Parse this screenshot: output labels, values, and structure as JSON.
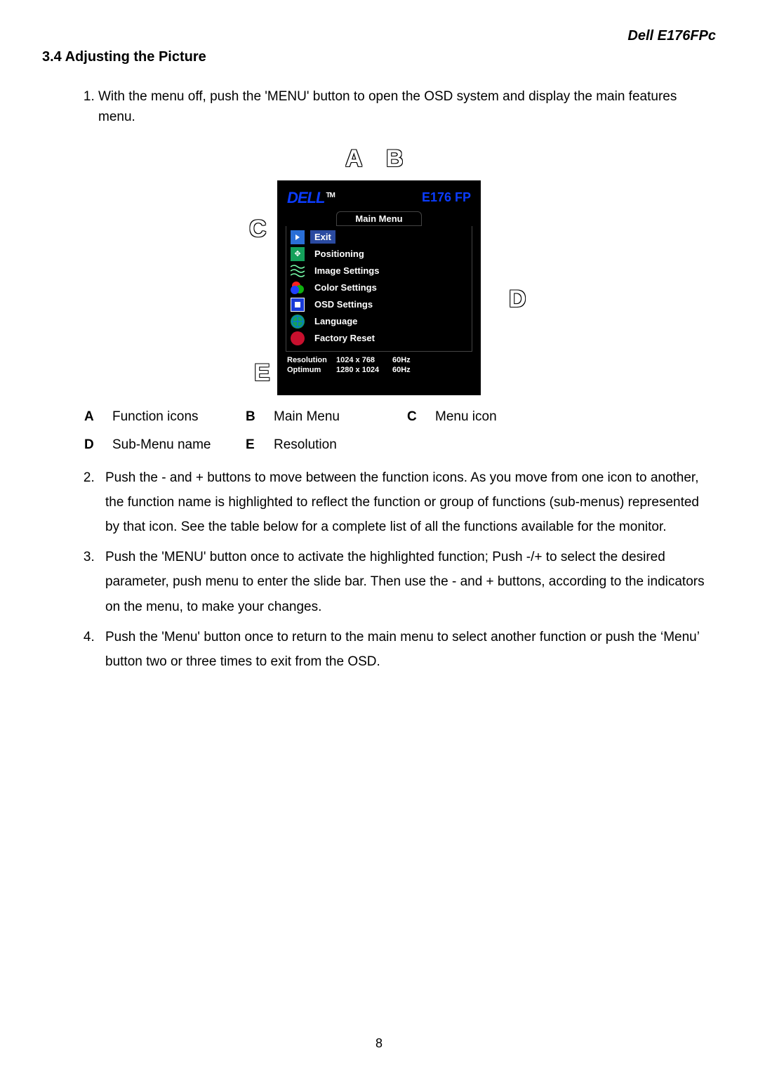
{
  "header_model": "Dell E176FPc",
  "section_title": "3.4 Adjusting the Picture",
  "step1": "With the menu off, push the 'MENU' button to open the OSD system and display the main features menu.",
  "osd": {
    "brand": "DELL",
    "tm": "TM",
    "model": "E176 FP",
    "main_menu_label": "Main Menu",
    "items": {
      "exit": "Exit",
      "positioning": "Positioning",
      "image": "Image Settings",
      "color": "Color Settings",
      "osd": "OSD Settings",
      "language": "Language",
      "reset": "Factory Reset"
    },
    "resolution_label": "Resolution",
    "resolution_value": "1024 x 768",
    "resolution_hz": "60Hz",
    "optimum_label": "Optimum",
    "optimum_value": "1280 x 1024",
    "optimum_hz": "60Hz"
  },
  "callouts": {
    "A": "A",
    "B": "B",
    "C": "C",
    "D": "D",
    "E": "E"
  },
  "legend": {
    "A": "Function icons",
    "B": "Main Menu",
    "C": "Menu icon",
    "D": "Sub-Menu name",
    "E": "Resolution"
  },
  "steps_rest": {
    "2": "Push the - and + buttons to move between the function icons. As you move from one icon to another, the function name is highlighted to reflect the function or group of functions (sub-menus) represented by that icon. See the table below for a complete list of all the functions available for the monitor.",
    "3": "Push the 'MENU' button once to activate the highlighted function; Push -/+ to select the desired parameter, push menu to enter the slide bar. Then use the - and + buttons, according to the indicators on the menu, to make your changes.",
    "4": "Push the 'Menu' button once to return to the main menu to select another function or push the ‘Menu’ button two or three times to exit from the OSD."
  },
  "page_number": "8"
}
